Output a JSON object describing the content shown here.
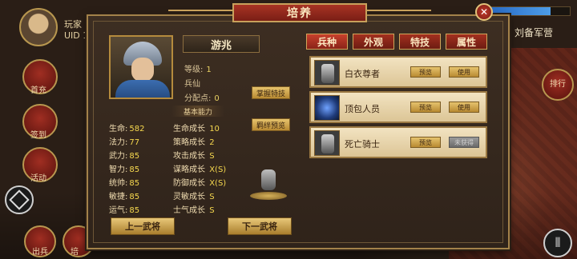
{
  "player": {
    "name": "玩家",
    "uid": "UID 1"
  },
  "side_buttons": [
    {
      "label": "首充"
    },
    {
      "label": "签到"
    },
    {
      "label": "活动"
    }
  ],
  "bottom_buttons": [
    {
      "label": "出兵"
    },
    {
      "label": "培"
    }
  ],
  "right": {
    "commander": "刘备军营",
    "rank_label": "排行",
    "hp_percent": 0.75
  },
  "dialog": {
    "title": "培养",
    "close": "✕"
  },
  "hero": {
    "name": "游兆",
    "level_label": "等级:",
    "level": "1",
    "class": "兵仙",
    "points_label": "分配点:",
    "points": "0",
    "skill_btn": "掌握特技",
    "bond_btn": "羁绊预览",
    "section_title": "基本能力"
  },
  "attrs_left": [
    {
      "k": "生命:",
      "v": "582"
    },
    {
      "k": "法力:",
      "v": "77"
    },
    {
      "k": "武力:",
      "v": "85"
    },
    {
      "k": "智力:",
      "v": "85"
    },
    {
      "k": "统帅:",
      "v": "85"
    },
    {
      "k": "敏捷:",
      "v": "85"
    },
    {
      "k": "运气:",
      "v": "85"
    }
  ],
  "attrs_right": [
    {
      "k": "生命成长",
      "v": "10"
    },
    {
      "k": "策略成长",
      "v": "2"
    },
    {
      "k": "攻击成长",
      "v": "S"
    },
    {
      "k": "谋略成长",
      "v": "X(S)"
    },
    {
      "k": "防御成长",
      "v": "X(S)"
    },
    {
      "k": "灵敏成长",
      "v": "S"
    },
    {
      "k": "士气成长",
      "v": "S"
    }
  ],
  "nav": {
    "prev": "上一武将",
    "next": "下一武将"
  },
  "tabs": [
    {
      "label": "兵种",
      "active": true
    },
    {
      "label": "外观",
      "active": false
    },
    {
      "label": "特技",
      "active": false
    },
    {
      "label": "属性",
      "active": false
    }
  ],
  "troops": [
    {
      "name": "白衣尊者",
      "preview": "预览",
      "use": "使用",
      "use_enabled": true,
      "icon": "knight-icon"
    },
    {
      "name": "顶包人员",
      "preview": "预览",
      "use": "使用",
      "use_enabled": true,
      "icon": "orb-icon"
    },
    {
      "name": "死亡骑士",
      "preview": "预览",
      "use": "未获得",
      "use_enabled": false,
      "icon": "knight-icon"
    }
  ],
  "colors": {
    "accent_red": "#a83424",
    "gold": "#c8a15b",
    "value_yellow": "#f6d84e"
  }
}
